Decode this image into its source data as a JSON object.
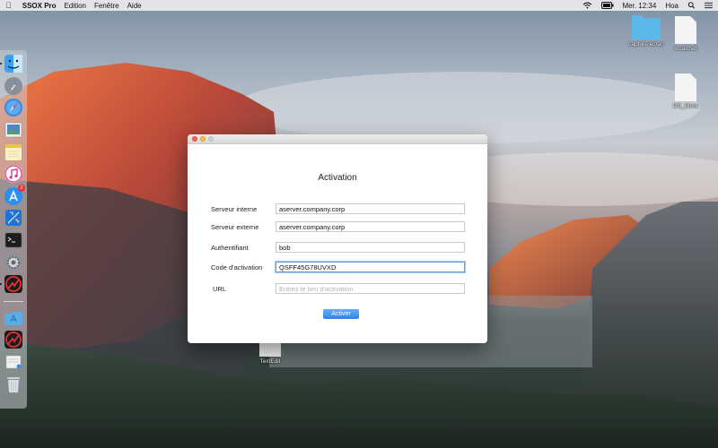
{
  "menubar": {
    "app_name": "SSOX Pro",
    "menus": [
      "Edition",
      "Fenêtre",
      "Aide"
    ],
    "clock": "Mer. 12:34",
    "user": "Hoa"
  },
  "desktop": {
    "icons": [
      {
        "label": "capture écran",
        "kind": "folder"
      },
      {
        "label": "localized",
        "kind": "document"
      },
      {
        "label": "DS_Store",
        "kind": "document"
      },
      {
        "label": "TextEdit",
        "kind": "document"
      }
    ]
  },
  "dock": {
    "items": [
      "finder",
      "launchpad",
      "safari",
      "preview",
      "notes",
      "itunes",
      "app-store",
      "xcode",
      "terminal",
      "system-preferences",
      "ssox-pro",
      "applications-folder",
      "ssox-pro-2",
      "downloads",
      "trash"
    ],
    "app_store_badge": "2"
  },
  "window": {
    "title": "Activation",
    "fields": [
      {
        "label": "Serveur interne",
        "value": "aserver.company.corp",
        "placeholder": ""
      },
      {
        "label": "Serveur externe",
        "value": "aserver.company.corp",
        "placeholder": ""
      },
      {
        "label": "Authentifiant",
        "value": "bob",
        "placeholder": ""
      },
      {
        "label": "Code d'activation",
        "value": "QSFF45G78UVXD",
        "placeholder": ""
      },
      {
        "label": "URL",
        "value": "",
        "placeholder": "Entrez le lien d'activation"
      }
    ],
    "button_label": "Activer"
  },
  "colors": {
    "accent": "#2f82ee",
    "focus_ring": "#5b9be8",
    "folder": "#5cb7ea"
  }
}
